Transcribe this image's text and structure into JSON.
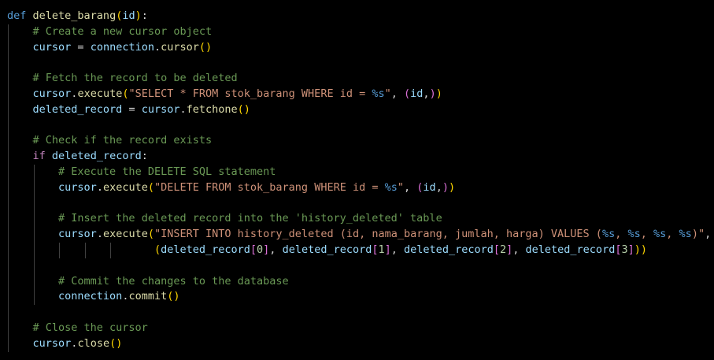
{
  "editor": {
    "code_lines": [
      "def delete_barang(id):",
      "    # Create a new cursor object",
      "    cursor = connection.cursor()",
      "",
      "    # Fetch the record to be deleted",
      "    cursor.execute(\"SELECT * FROM stok_barang WHERE id = %s\", (id,))",
      "    deleted_record = cursor.fetchone()",
      "",
      "    # Check if the record exists",
      "    if deleted_record:",
      "        # Execute the DELETE SQL statement",
      "        cursor.execute(\"DELETE FROM stok_barang WHERE id = %s\", (id,))",
      "",
      "        # Insert the deleted record into the 'history_deleted' table",
      "        cursor.execute(\"INSERT INTO history_deleted (id, nama_barang, jumlah, harga) VALUES (%s, %s, %s, %s)\",",
      "                       (deleted_record[0], deleted_record[1], deleted_record[2], deleted_record[3]))",
      "",
      "        # Commit the changes to the database",
      "        connection.commit()",
      "",
      "    # Close the cursor",
      "    cursor.close()"
    ],
    "colors": {
      "background": "#000000",
      "keyword": "#569cd6",
      "control_keyword": "#c586c0",
      "function": "#dcdcaa",
      "variable": "#9cdcfe",
      "string": "#ce9178",
      "number": "#b5cea8",
      "comment": "#6a9955",
      "bracket_level_1": "#ffd700",
      "bracket_level_2": "#da70d6",
      "bracket_level_3": "#179fff",
      "spell_squiggle": "#3794ff"
    }
  }
}
